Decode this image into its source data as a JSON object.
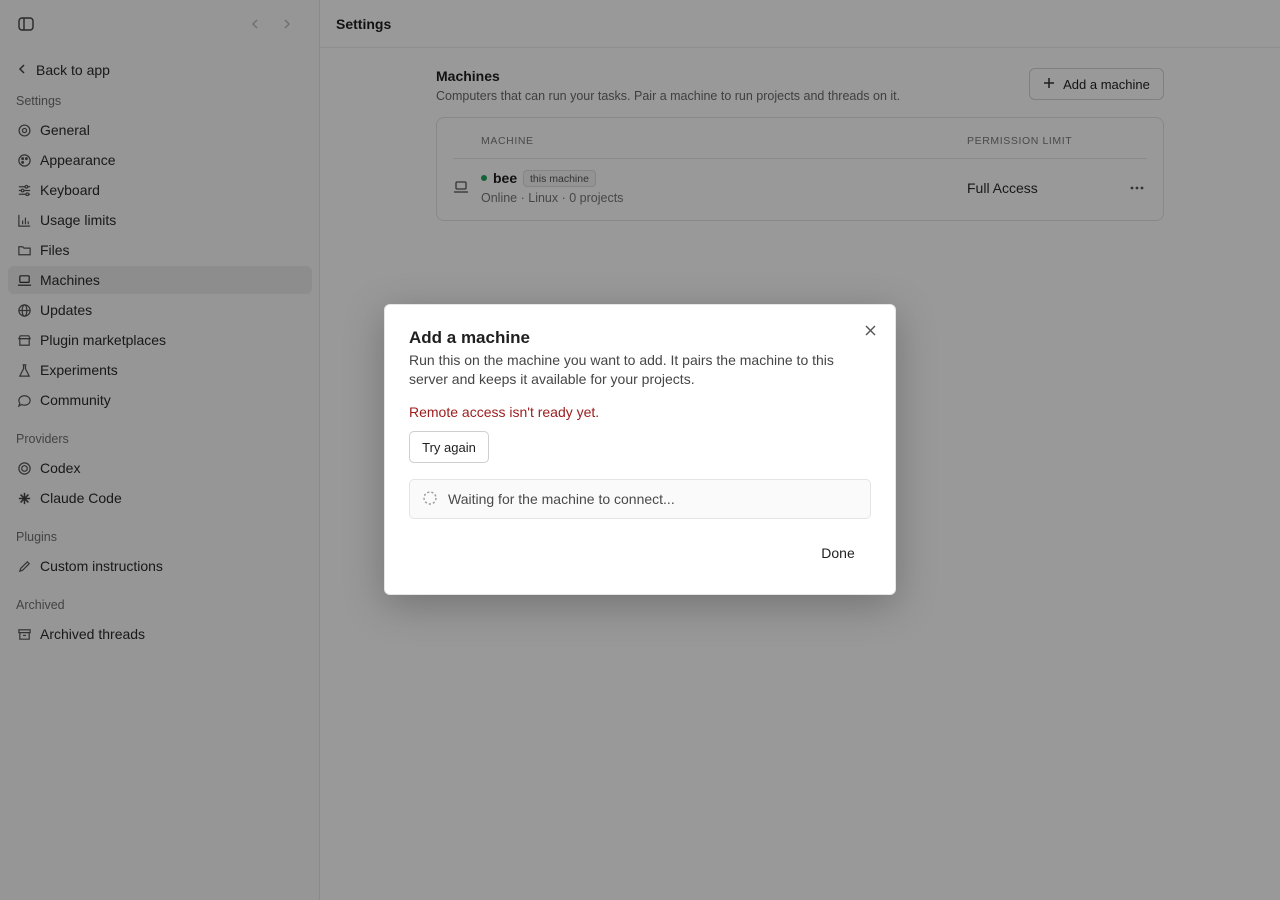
{
  "sidebar": {
    "back_label": "Back to app",
    "sections": {
      "settings": "Settings",
      "providers": "Providers",
      "plugins": "Plugins",
      "archived": "Archived"
    },
    "settings_items": [
      {
        "label": "General",
        "icon": "gear-icon"
      },
      {
        "label": "Appearance",
        "icon": "palette-icon"
      },
      {
        "label": "Keyboard",
        "icon": "sliders-icon"
      },
      {
        "label": "Usage limits",
        "icon": "bar-chart-icon"
      },
      {
        "label": "Files",
        "icon": "folder-icon"
      },
      {
        "label": "Machines",
        "icon": "laptop-icon",
        "active": true
      },
      {
        "label": "Updates",
        "icon": "globe-icon"
      },
      {
        "label": "Plugin marketplaces",
        "icon": "store-icon"
      },
      {
        "label": "Experiments",
        "icon": "flask-icon"
      },
      {
        "label": "Community",
        "icon": "chat-icon"
      }
    ],
    "provider_items": [
      {
        "label": "Codex",
        "icon": "codex-icon"
      },
      {
        "label": "Claude Code",
        "icon": "claude-icon"
      }
    ],
    "plugin_items": [
      {
        "label": "Custom instructions",
        "icon": "pencil-icon"
      }
    ],
    "archived_items": [
      {
        "label": "Archived threads",
        "icon": "archive-icon"
      }
    ]
  },
  "main": {
    "header_title": "Settings",
    "machines": {
      "title": "Machines",
      "subtitle": "Computers that can run your tasks. Pair a machine to run projects and threads on it.",
      "add_button": "Add a machine",
      "columns": [
        "Machine",
        "Permission limit"
      ],
      "rows": [
        {
          "name": "bee",
          "badge": "this machine",
          "meta": "Online · Linux · 0 projects",
          "permission": "Full Access",
          "status_color": "#22a55b"
        }
      ]
    }
  },
  "dialog": {
    "title": "Add a machine",
    "description": "Run this on the machine you want to add. It pairs the machine to this server and keeps it available for your projects.",
    "error": "Remote access isn't ready yet.",
    "try_again": "Try again",
    "waiting": "Waiting for the machine to connect...",
    "done": "Done"
  }
}
